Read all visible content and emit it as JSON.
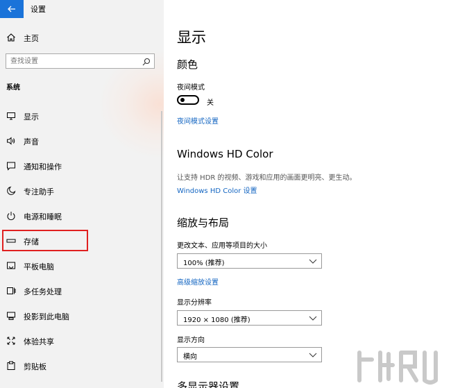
{
  "app": {
    "title": "设置"
  },
  "sidebar": {
    "home_label": "主页",
    "search_placeholder": "查找设置",
    "section": "系统",
    "items": [
      {
        "label": "显示",
        "icon": "monitor-icon"
      },
      {
        "label": "声音",
        "icon": "speaker-icon"
      },
      {
        "label": "通知和操作",
        "icon": "notification-icon"
      },
      {
        "label": "专注助手",
        "icon": "moon-icon"
      },
      {
        "label": "电源和睡眠",
        "icon": "power-icon"
      },
      {
        "label": "存储",
        "icon": "storage-icon"
      },
      {
        "label": "平板电脑",
        "icon": "tablet-icon"
      },
      {
        "label": "多任务处理",
        "icon": "multitask-icon"
      },
      {
        "label": "投影到此电脑",
        "icon": "project-icon"
      },
      {
        "label": "体验共享",
        "icon": "share-icon"
      },
      {
        "label": "剪贴板",
        "icon": "clipboard-icon"
      }
    ],
    "selected_index": 5
  },
  "main": {
    "title": "显示",
    "color_section": {
      "heading": "颜色",
      "night_label": "夜间模式",
      "toggle_state": "关",
      "night_link": "夜间模式设置"
    },
    "hdr_section": {
      "heading": "Windows HD Color",
      "description": "让支持 HDR 的视频、游戏和应用的画面更明亮、更生动。",
      "link": "Windows HD Color 设置"
    },
    "scale_section": {
      "heading": "缩放与布局",
      "scale_label": "更改文本、应用等项目的大小",
      "scale_value": "100% (推荐)",
      "advanced_link": "高级缩放设置",
      "resolution_label": "显示分辨率",
      "resolution_value": "1920 × 1080 (推荐)",
      "orientation_label": "显示方向",
      "orientation_value": "横向"
    },
    "next_heading": "多显示器设置"
  },
  "colors": {
    "accent": "#1a73d9",
    "link": "#1466c2",
    "highlight": "#e02020"
  }
}
